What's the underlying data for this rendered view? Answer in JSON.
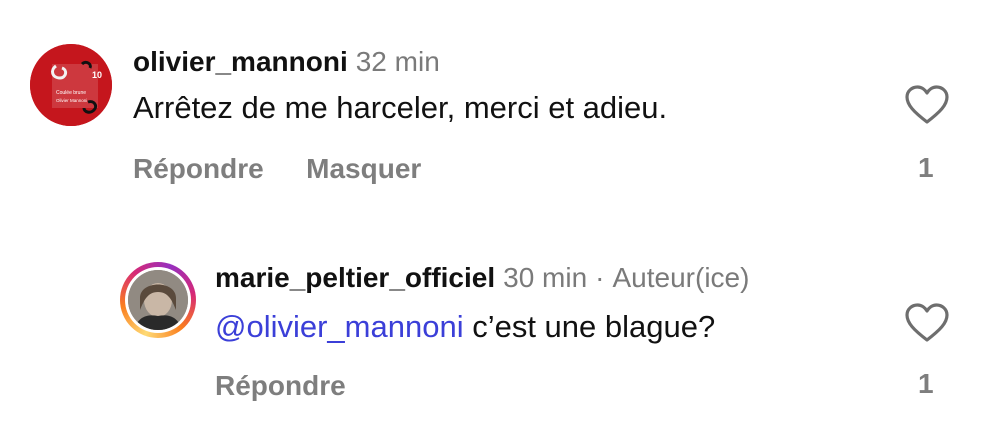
{
  "comments": [
    {
      "username": "olivier_mannoni",
      "time": "32 min",
      "text": "Arrêtez de me harceler, merci et adieu.",
      "actions": [
        "Répondre",
        "Masquer"
      ],
      "likes": "1",
      "avatar": {
        "text_top": "10",
        "text_mid": "Coulée brune",
        "text_bottom": "Olivier Mannoni"
      }
    }
  ],
  "reply": {
    "username": "marie_peltier_officiel",
    "time": "30 min",
    "separator": "·",
    "role": "Auteur(ice)",
    "mention": "@olivier_mannoni",
    "text": " c’est une blague?",
    "actions": [
      "Répondre"
    ],
    "likes": "1"
  },
  "colors": {
    "mention": "#3b3fd8",
    "muted": "#7a7a7a",
    "avatar_red": "#c5161d"
  },
  "icons": {
    "like": "heart-outline-icon"
  }
}
